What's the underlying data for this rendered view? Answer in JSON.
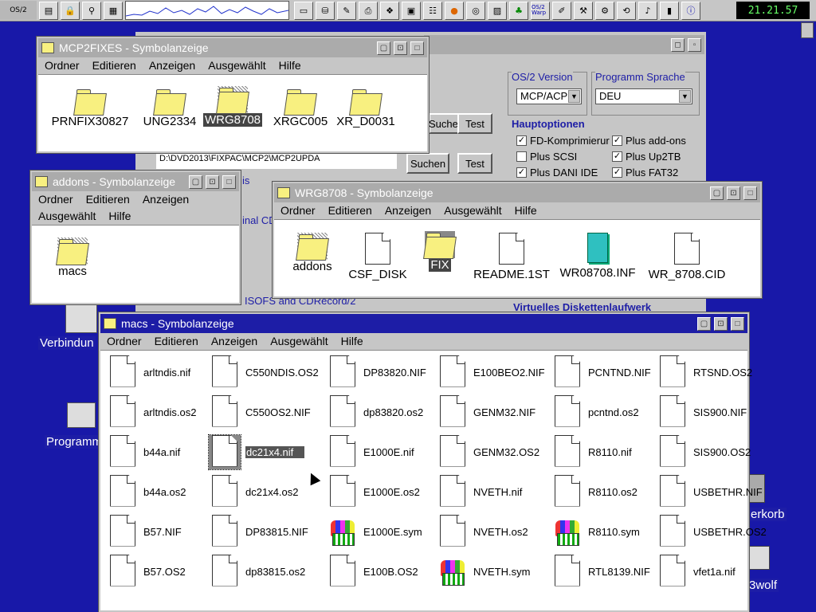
{
  "warpcenter": {
    "logo": "OS/2",
    "clock": "21.21.57",
    "os2warp_badge": "OS/2 Warp",
    "icons": [
      "window-list-icon",
      "lock-icon",
      "find-icon",
      "system-monitor-icon",
      "tray-icon",
      "drives-icon",
      "settings-icon",
      "printer-icon",
      "folder-app-icon",
      "program-icon",
      "firefox-icon",
      "disk-icon",
      "photo-icon",
      "tree-icon",
      "os2warp-icon",
      "editor-icon",
      "tool-icon",
      "tool2-icon",
      "network-icon",
      "sound-icon",
      "battery-icon",
      "help-icon"
    ]
  },
  "settings_window": {
    "os2_version": {
      "title": "OS/2 Version",
      "value": "MCP/ACP"
    },
    "language": {
      "title": "Programm Sprache",
      "value": "DEU"
    },
    "test_button_1": "Test",
    "suchen_button_1": "Suchen",
    "test_button_2": "Test",
    "suchen_button_2": "Suchen",
    "path_value": "D:\\DVD2013\\FIXPAC\\MCP2\\MCP2UPDA",
    "hauptoptionen": "Hauptoptionen",
    "options": [
      {
        "label": "FD-Komprimierur",
        "checked": true
      },
      {
        "label": "Plus add-ons",
        "checked": true
      },
      {
        "label": "Plus SCSI",
        "checked": false
      },
      {
        "label": "Plus Up2TB",
        "checked": true
      },
      {
        "label": "Plus DANI IDE",
        "checked": true
      },
      {
        "label": "Plus FAT32",
        "checked": true
      }
    ],
    "virtual_floppy": "Virtuelles Diskettenlaufwerk",
    "partial_is": "is",
    "partial_cd": "inal CD",
    "partial_isofs": "ISOFS and CDRecord/2"
  },
  "windows": {
    "mcp2fixes": {
      "title": "MCP2FIXES - Symbolanzeige",
      "menu": [
        "Ordner",
        "Editieren",
        "Anzeigen",
        "Ausgewählt",
        "Hilfe"
      ],
      "items": [
        "PRNFIX30827",
        "UNG2334",
        "WRG8708",
        "XRGC005",
        "XR_D0031"
      ]
    },
    "addons": {
      "title": "addons - Symbolanzeige",
      "menu": [
        "Ordner",
        "Editieren",
        "Anzeigen",
        "Ausgewählt",
        "Hilfe"
      ],
      "items": [
        "macs"
      ]
    },
    "wrg8708": {
      "title": "WRG8708 - Symbolanzeige",
      "menu": [
        "Ordner",
        "Editieren",
        "Anzeigen",
        "Ausgewählt",
        "Hilfe"
      ],
      "items": [
        "addons",
        "CSF_DISK",
        "FIX",
        "README.1ST",
        "WR08708.INF",
        "WR_8708.CID"
      ]
    },
    "macs": {
      "title": "macs - Symbolanzeige",
      "menu": [
        "Ordner",
        "Editieren",
        "Anzeigen",
        "Ausgewählt",
        "Hilfe"
      ],
      "columns": [
        [
          "arltndis.nif",
          "arltndis.os2",
          "b44a.nif",
          "b44a.os2",
          "B57.NIF",
          "B57.OS2"
        ],
        [
          "C550NDIS.OS2",
          "C550OS2.NIF",
          "dc21x4.nif",
          "dc21x4.os2",
          "DP83815.NIF",
          "dp83815.os2"
        ],
        [
          "DP83820.NIF",
          "dp83820.os2",
          "E1000E.nif",
          "E1000E.os2",
          "E1000E.sym",
          "E100B.OS2"
        ],
        [
          "E100BEO2.NIF",
          "GENM32.NIF",
          "GENM32.OS2",
          "NVETH.nif",
          "NVETH.os2",
          "NVETH.sym"
        ],
        [
          "PCNTND.NIF",
          "pcntnd.os2",
          "R8110.nif",
          "R8110.os2",
          "R8110.sym",
          "RTL8139.NIF"
        ],
        [
          "RTSND.OS2",
          "SIS900.NIF",
          "SIS900.OS2",
          "USBETHR.NIF",
          "USBETHR.OS2",
          "vfet1a.nif"
        ]
      ]
    }
  },
  "desktop": {
    "verbindungen": "Verbindun",
    "programme": "Programm",
    "papierkorb": "erkorb",
    "wolf": "3wolf"
  }
}
